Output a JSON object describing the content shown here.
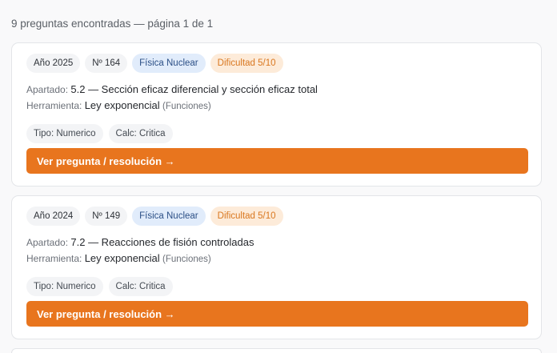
{
  "summary": "9 preguntas encontradas — página 1 de 1",
  "colors": {
    "accent": "#e8751e",
    "topic_badge_bg": "#e1ecfb",
    "difficulty_badge_bg": "#fdebd9"
  },
  "cards": [
    {
      "year": "Año 2025",
      "number": "Nº 164",
      "topic": "Física Nuclear",
      "difficulty": "Dificultad 5/10",
      "section_label": "Apartado:",
      "section_value": "5.2 — Sección eficaz diferencial y sección eficaz total",
      "tool_label": "Herramienta:",
      "tool_value": "Ley exponencial",
      "tool_category": "(Funciones)",
      "type_tag": "Tipo: Numerico",
      "calc_tag": "Calc: Critica",
      "button": "Ver pregunta / resolución →"
    },
    {
      "year": "Año 2024",
      "number": "Nº 149",
      "topic": "Física Nuclear",
      "difficulty": "Dificultad 5/10",
      "section_label": "Apartado:",
      "section_value": "7.2 — Reacciones de fisión controladas",
      "tool_label": "Herramienta:",
      "tool_value": "Ley exponencial",
      "tool_category": "(Funciones)",
      "type_tag": "Tipo: Numerico",
      "calc_tag": "Calc: Critica",
      "button": "Ver pregunta / resolución →"
    }
  ]
}
